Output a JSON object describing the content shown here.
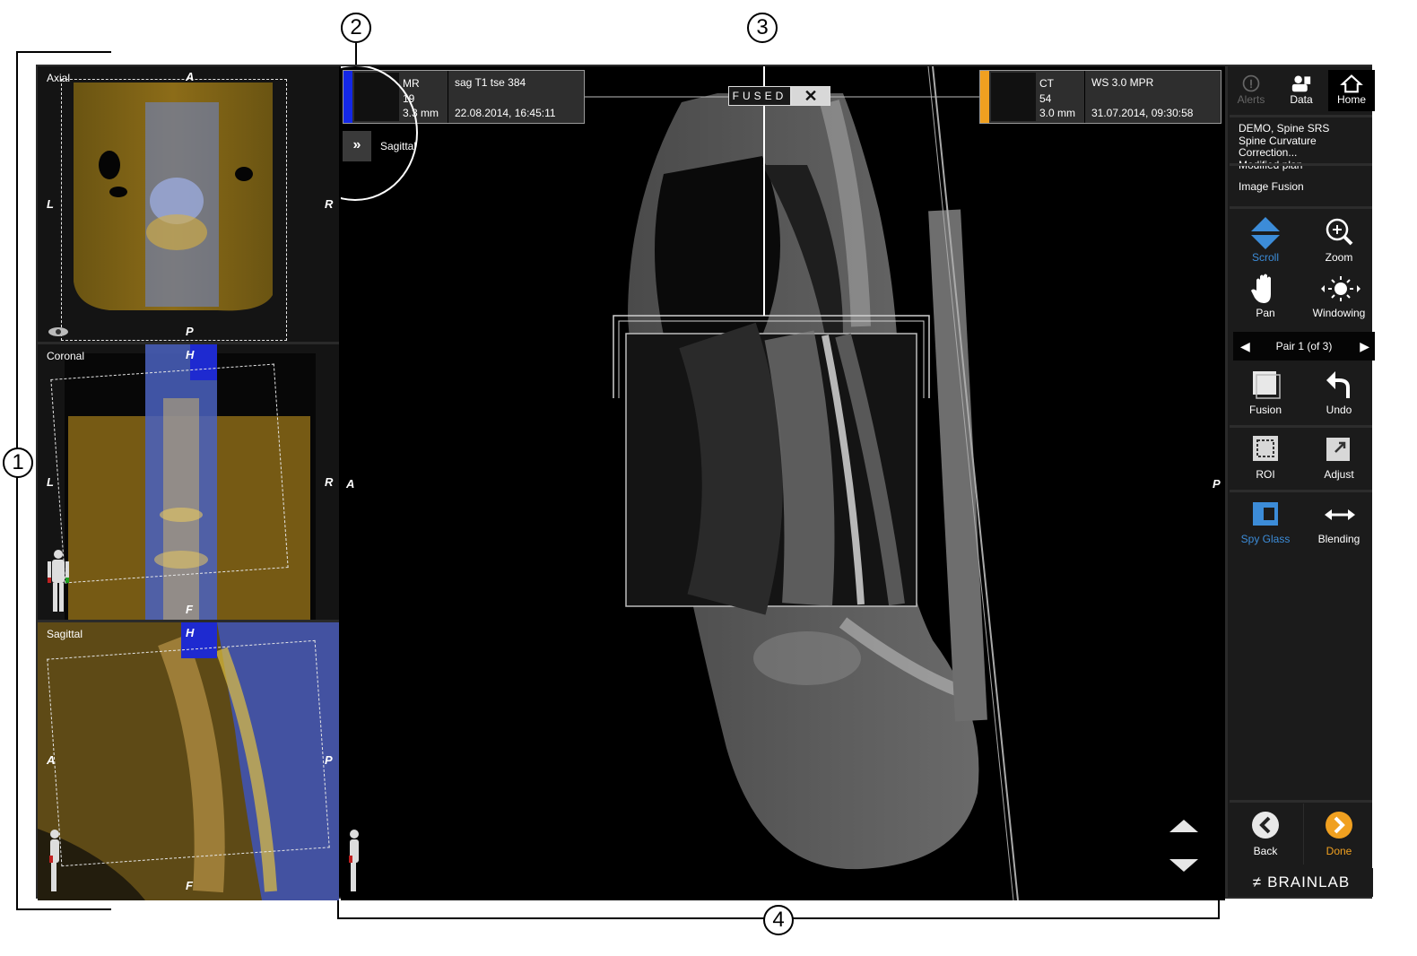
{
  "callouts": [
    "1",
    "2",
    "3",
    "4"
  ],
  "left_panel": {
    "axial": {
      "title": "Axial",
      "top": "A",
      "left": "L",
      "right": "R",
      "bottom": "P"
    },
    "coronal": {
      "title": "Coronal",
      "top": "H",
      "left": "L",
      "right": "R",
      "bottom": "F"
    },
    "sagittal": {
      "title": "Sagittal",
      "top": "H",
      "left": "A",
      "right": "P",
      "bottom": "F"
    }
  },
  "main_view": {
    "mr_info": {
      "modality": "MR",
      "slice": "19",
      "thickness": "3.3 mm",
      "series": "sag T1 tse 384",
      "date": "22.08.2014, 16:45:11",
      "color": "#1428e6"
    },
    "ct_info": {
      "modality": "CT",
      "slice": "54",
      "thickness": "3.0 mm",
      "series": "WS 3.0 MPR",
      "date": "31.07.2014, 09:30:58",
      "color": "#f0a020"
    },
    "fused_label": "FUSED",
    "close_icon": "✕",
    "view_toggle_icon": "»",
    "view_toggle_label": "Sagittal",
    "orient_left": "A",
    "orient_right": "P"
  },
  "right_panel": {
    "tabs": [
      {
        "label": "Alerts",
        "icon": "alert-icon"
      },
      {
        "label": "Data",
        "icon": "data-icon"
      },
      {
        "label": "Home",
        "icon": "home-icon"
      }
    ],
    "patient": {
      "line1": "DEMO, Spine SRS",
      "line2": "Spine Curvature Correction...",
      "line3": "Modified plan"
    },
    "step": "Image Fusion",
    "tools_view": [
      {
        "label": "Scroll",
        "icon": "scroll-icon",
        "active": true
      },
      {
        "label": "Zoom",
        "icon": "zoom-icon"
      },
      {
        "label": "Pan",
        "icon": "pan-hand-icon"
      },
      {
        "label": "Windowing",
        "icon": "windowing-icon"
      }
    ],
    "pair_label": "Pair 1 (of 3)",
    "tools_fusion": [
      {
        "label": "Fusion",
        "icon": "fusion-icon"
      },
      {
        "label": "Undo",
        "icon": "undo-icon"
      },
      {
        "label": "ROI",
        "icon": "roi-icon"
      },
      {
        "label": "Adjust",
        "icon": "adjust-icon"
      },
      {
        "label": "Spy Glass",
        "icon": "spy-glass-icon",
        "active": true
      },
      {
        "label": "Blending",
        "icon": "blending-icon"
      }
    ],
    "back_label": "Back",
    "done_label": "Done",
    "brand": "BRAINLAB"
  },
  "colors": {
    "accent_blue": "#3c8cd8",
    "accent_orange": "#f0a020",
    "fusion_yellow": "#8a6a14",
    "fusion_blue": "#3a5ad0"
  }
}
